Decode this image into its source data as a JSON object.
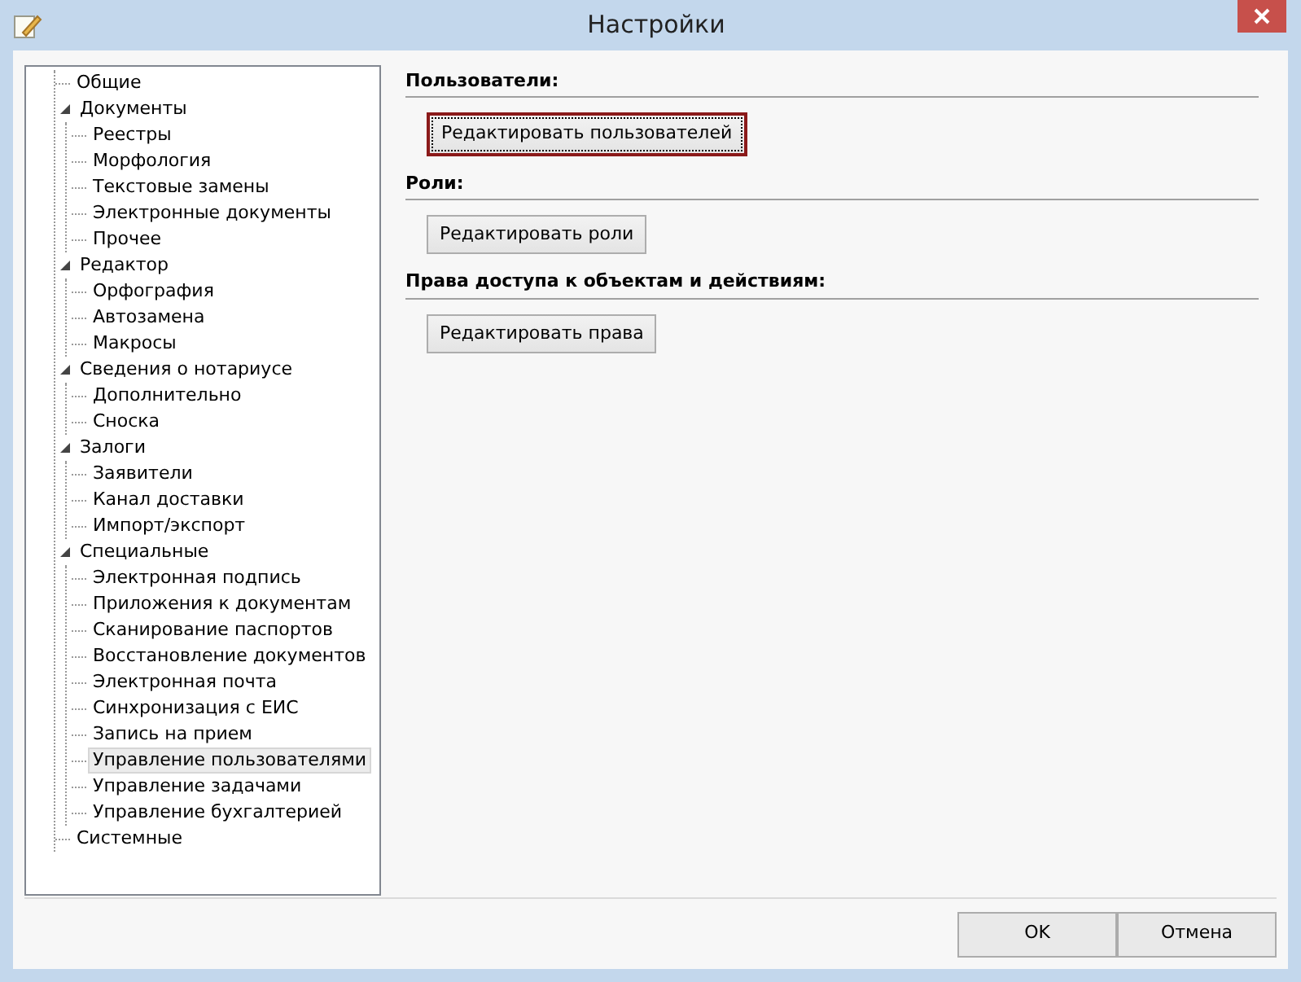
{
  "window": {
    "title": "Настройки"
  },
  "tree": [
    {
      "label": "Общие",
      "selected": false
    },
    {
      "label": "Документы",
      "selected": false,
      "expanded": true,
      "children": [
        {
          "label": "Реестры",
          "selected": false
        },
        {
          "label": "Морфология",
          "selected": false
        },
        {
          "label": "Текстовые замены",
          "selected": false
        },
        {
          "label": "Электронные документы",
          "selected": false
        },
        {
          "label": "Прочее",
          "selected": false
        }
      ]
    },
    {
      "label": "Редактор",
      "selected": false,
      "expanded": true,
      "children": [
        {
          "label": "Орфография",
          "selected": false
        },
        {
          "label": "Автозамена",
          "selected": false
        },
        {
          "label": "Макросы",
          "selected": false
        }
      ]
    },
    {
      "label": "Сведения о нотариусе",
      "selected": false,
      "expanded": true,
      "children": [
        {
          "label": "Дополнительно",
          "selected": false
        },
        {
          "label": "Сноска",
          "selected": false
        }
      ]
    },
    {
      "label": "Залоги",
      "selected": false,
      "expanded": true,
      "children": [
        {
          "label": "Заявители",
          "selected": false
        },
        {
          "label": "Канал доставки",
          "selected": false
        },
        {
          "label": "Импорт/экспорт",
          "selected": false
        }
      ]
    },
    {
      "label": "Специальные",
      "selected": false,
      "expanded": true,
      "children": [
        {
          "label": "Электронная подпись",
          "selected": false
        },
        {
          "label": "Приложения к документам",
          "selected": false
        },
        {
          "label": "Сканирование паспортов",
          "selected": false
        },
        {
          "label": "Восстановление документов",
          "selected": false
        },
        {
          "label": "Электронная почта",
          "selected": false
        },
        {
          "label": "Синхронизация с ЕИС",
          "selected": false
        },
        {
          "label": "Запись на прием",
          "selected": false
        },
        {
          "label": "Управление пользователями",
          "selected": true
        },
        {
          "label": "Управление задачами",
          "selected": false
        },
        {
          "label": "Управление бухгалтерией",
          "selected": false
        }
      ]
    },
    {
      "label": "Системные",
      "selected": false
    }
  ],
  "sections": [
    {
      "title": "Пользователи:",
      "button": "Редактировать пользователей",
      "focused": true
    },
    {
      "title": "Роли:",
      "button": "Редактировать роли",
      "focused": false
    },
    {
      "title": "Права доступа к объектам и действиям:",
      "button": "Редактировать права",
      "focused": false
    }
  ],
  "buttons": [
    "OK",
    "Отмена"
  ]
}
